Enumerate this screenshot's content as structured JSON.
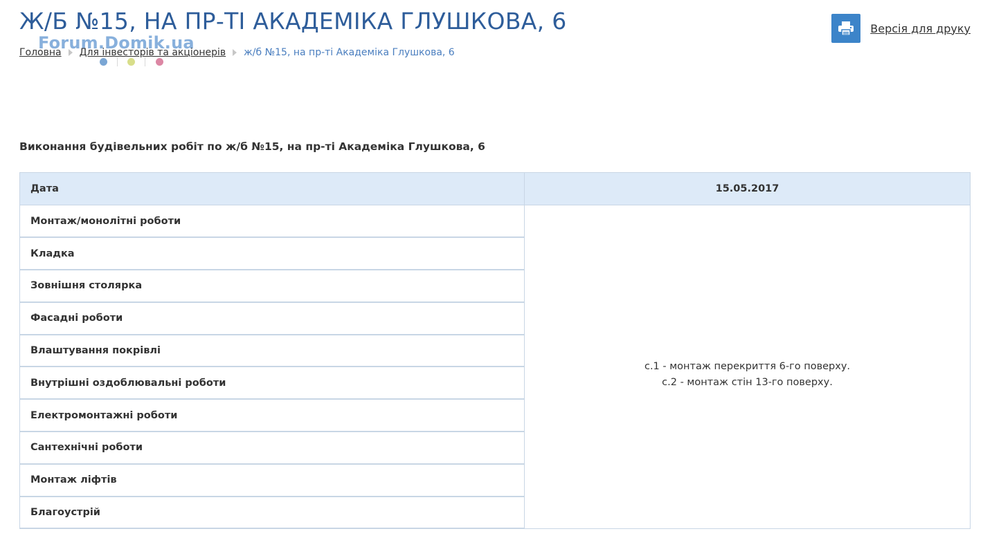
{
  "page": {
    "title": "Ж/Б №15, НА ПР-ТІ АКАДЕМІКА ГЛУШКОВА, 6"
  },
  "print": {
    "icon": "printer-icon",
    "label": "Версія для друку"
  },
  "breadcrumb": {
    "items": [
      {
        "label": "Головна"
      },
      {
        "label": "Для інвесторів та акціонерів"
      },
      {
        "label": "ж/б №15, на пр-ті Академіка Глушкова, 6"
      }
    ]
  },
  "watermark": {
    "text": "Forum.Domik.ua",
    "dot_colors": [
      "#7aa6d4",
      "#d8de8a",
      "#dc87a4"
    ]
  },
  "section": {
    "heading": "Виконання будівельних робіт по ж/б №15, на пр-ті Академіка Глушкова, 6"
  },
  "table": {
    "header": {
      "label": "Дата",
      "value": "15.05.2017"
    },
    "rows": [
      {
        "label": "Монтаж/монолітні роботи"
      },
      {
        "label": "Кладка"
      },
      {
        "label": "Зовнішня столярка"
      },
      {
        "label": "Фасадні роботи"
      },
      {
        "label": "Влаштування покрівлі"
      },
      {
        "label": "Внутрішні оздоблювальні роботи"
      },
      {
        "label": "Електромонтажні роботи"
      },
      {
        "label": "Сантехнічні роботи"
      },
      {
        "label": "Монтаж ліфтів"
      },
      {
        "label": "Благоустрій"
      }
    ],
    "status_lines": [
      "с.1 - монтаж перекриття 6-го поверху.",
      "с.2 - монтаж стін 13-го поверху."
    ]
  },
  "colors": {
    "title": "#2e5d9a",
    "print_button": "#3c84c9",
    "breadcrumb_current": "#4a7ebf",
    "table_header_bg": "#ddeaf8",
    "table_border": "#c8d6e5"
  }
}
